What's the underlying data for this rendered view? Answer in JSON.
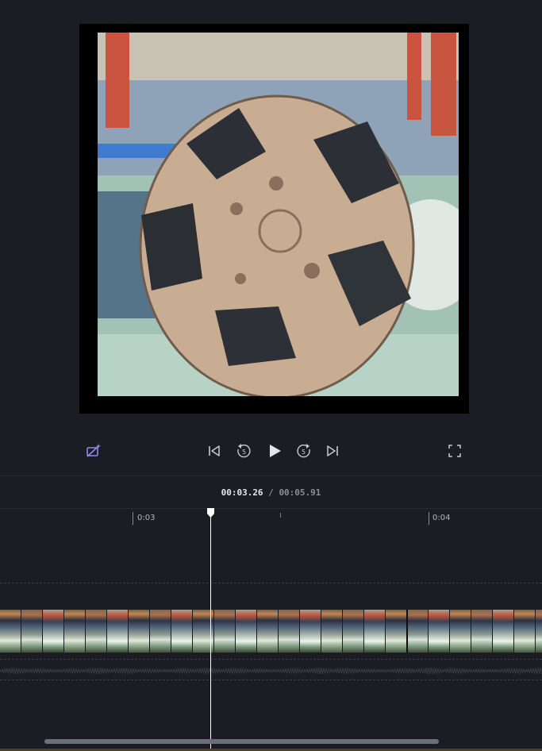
{
  "player": {
    "controls": [
      {
        "name": "ai-erase-camera-icon"
      },
      {
        "name": "skip-to-start-icon"
      },
      {
        "name": "rewind-5-icon",
        "label": "5"
      },
      {
        "name": "play-icon"
      },
      {
        "name": "forward-5-icon",
        "label": "5"
      },
      {
        "name": "skip-to-end-icon"
      },
      {
        "name": "fullscreen-icon"
      }
    ],
    "rewind_seconds": "5",
    "forward_seconds": "5"
  },
  "timeline": {
    "current_time": "00:03.26",
    "separator": " / ",
    "total_time": "00:05.91",
    "ruler_labels": [
      "0:03",
      "0:04"
    ]
  },
  "colors": {
    "background": "#1c1c24",
    "accent": "#8f8ce8",
    "playhead": "#ffffff"
  }
}
